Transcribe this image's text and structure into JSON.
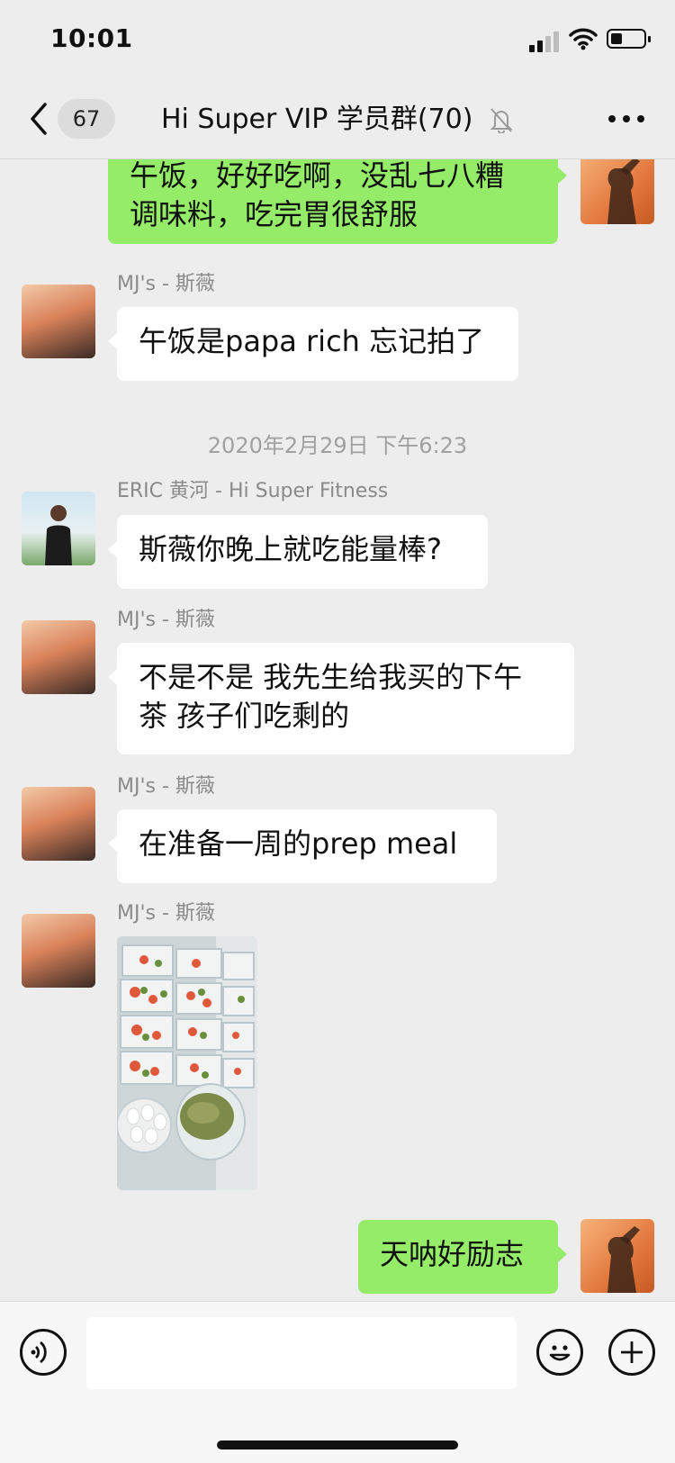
{
  "status_bar": {
    "time": "10:01"
  },
  "header": {
    "back_badge": "67",
    "title": "Hi Super VIP 学员群(70)"
  },
  "messages": [
    {
      "from": "me",
      "lines": [
        "午饭，好好吃啊，没乱七八糟",
        "调味料，吃完胃很舒服"
      ]
    },
    {
      "from": "MJ's - 斯薇",
      "text": "午饭是papa rich 忘记拍了"
    },
    {
      "timestamp": "2020年2月29日 下午6:23"
    },
    {
      "from": "ERIC 黄河 - Hi Super Fitness",
      "text": "斯薇你晚上就吃能量棒?"
    },
    {
      "from": "MJ's - 斯薇",
      "lines": [
        "不是不是 我先生给我买的下午",
        "茶 孩子们吃剩的"
      ]
    },
    {
      "from": "MJ's - 斯薇",
      "text": "在准备一周的prep meal"
    },
    {
      "from": "MJ's - 斯薇",
      "type": "image"
    },
    {
      "from": "me",
      "text": "天呐好励志"
    }
  ],
  "input_bar": {
    "voice_icon": "voice-icon",
    "emoji_icon": "emoji-icon",
    "plus_icon": "plus-icon"
  }
}
